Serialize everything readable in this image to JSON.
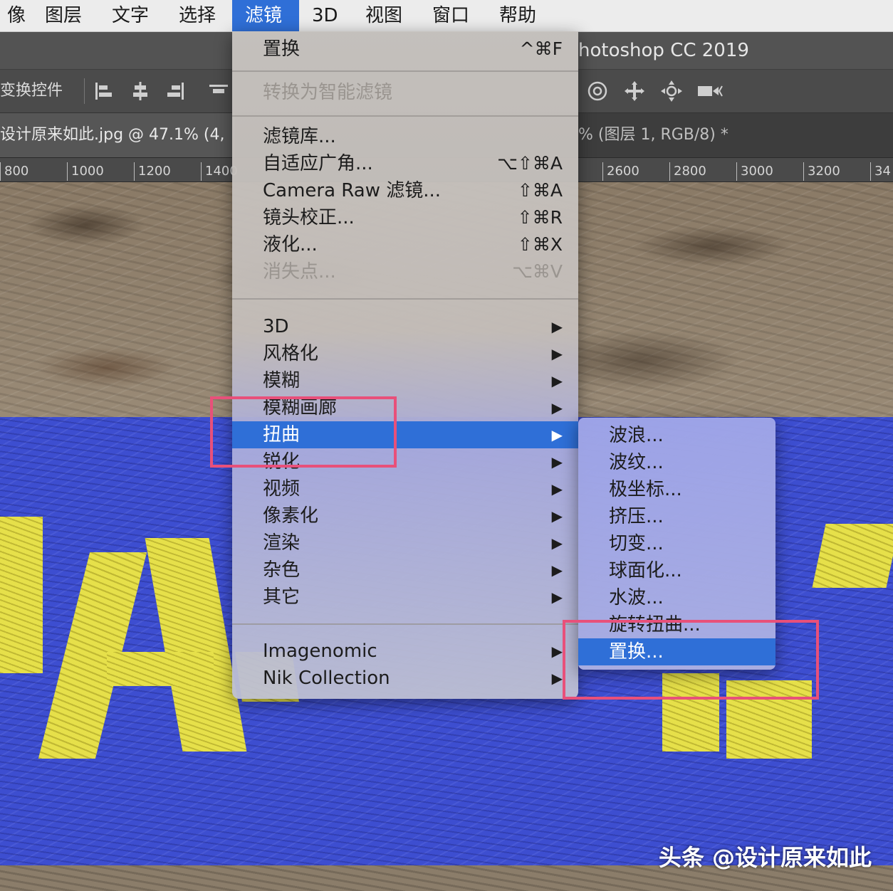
{
  "menubar": {
    "items": [
      {
        "label": "像"
      },
      {
        "label": "图层"
      },
      {
        "label": "文字"
      },
      {
        "label": "选择"
      },
      {
        "label": "滤镜"
      },
      {
        "label": "3D"
      },
      {
        "label": "视图"
      },
      {
        "label": "窗口"
      },
      {
        "label": "帮助"
      }
    ]
  },
  "window": {
    "title": "hotoshop CC 2019"
  },
  "options_bar": {
    "label": "变换控件",
    "icons": [
      "align-left-icon",
      "align-center-icon",
      "align-right-icon",
      "distribute-icon",
      "rotate-3d-icon",
      "pan-3d-icon",
      "slide-3d-icon",
      "scale-3d-icon",
      "video-camera-icon"
    ]
  },
  "document": {
    "tab_label": "设计原来如此.jpg @ 47.1% (4,",
    "tab_label_right": "% (图层 1, RGB/8) *"
  },
  "ruler": {
    "ticks": [
      "800",
      "1000",
      "1200",
      "1400",
      "2600",
      "2800",
      "3000",
      "3200",
      "34"
    ]
  },
  "filter_menu": {
    "items": [
      {
        "label": "置换",
        "shortcut": "^⌘F"
      },
      {
        "label": "转换为智能滤镜",
        "disabled": true
      },
      {
        "label": "滤镜库..."
      },
      {
        "label": "自适应广角...",
        "shortcut": "⌥⇧⌘A"
      },
      {
        "label": "Camera Raw 滤镜...",
        "shortcut": "⇧⌘A"
      },
      {
        "label": "镜头校正...",
        "shortcut": "⇧⌘R"
      },
      {
        "label": "液化...",
        "shortcut": "⇧⌘X"
      },
      {
        "label": "消失点...",
        "shortcut": "⌥⌘V",
        "disabled": true
      },
      {
        "label": "3D",
        "submenu": true
      },
      {
        "label": "风格化",
        "submenu": true
      },
      {
        "label": "模糊",
        "submenu": true
      },
      {
        "label": "模糊画廊",
        "submenu": true
      },
      {
        "label": "扭曲",
        "submenu": true,
        "highlighted": true
      },
      {
        "label": "锐化",
        "submenu": true
      },
      {
        "label": "视频",
        "submenu": true
      },
      {
        "label": "像素化",
        "submenu": true
      },
      {
        "label": "渲染",
        "submenu": true
      },
      {
        "label": "杂色",
        "submenu": true
      },
      {
        "label": "其它",
        "submenu": true
      },
      {
        "label": "Imagenomic",
        "submenu": true
      },
      {
        "label": "Nik Collection",
        "submenu": true
      }
    ],
    "arrow": "▶"
  },
  "distort_submenu": {
    "items": [
      {
        "label": "波浪..."
      },
      {
        "label": "波纹..."
      },
      {
        "label": "极坐标..."
      },
      {
        "label": "挤压..."
      },
      {
        "label": "切变..."
      },
      {
        "label": "球面化..."
      },
      {
        "label": "水波..."
      },
      {
        "label": "旋转扭曲..."
      },
      {
        "label": "置换...",
        "highlighted": true
      }
    ]
  },
  "watermark": {
    "text": "头条 @设计原来如此"
  },
  "colors": {
    "menu_highlight": "#2f6fd7",
    "annotation": "#e8507a",
    "paint_blue": "#3d4ed0",
    "paint_yellow": "#e6e04a"
  }
}
